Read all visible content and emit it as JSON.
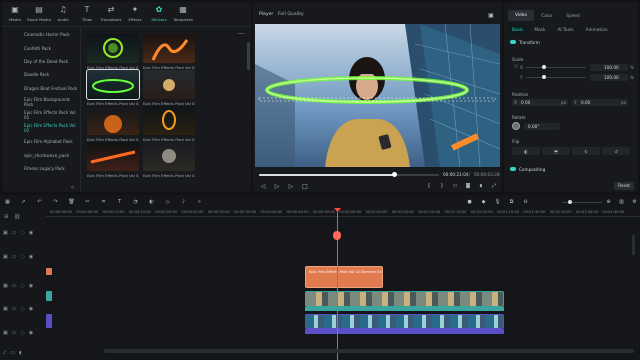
{
  "toolbar": {
    "items": [
      {
        "icon": "media-icon",
        "label": "Media"
      },
      {
        "icon": "stock-media-icon",
        "label": "Stock Media"
      },
      {
        "icon": "audio-icon",
        "label": "Audio"
      },
      {
        "icon": "titles-icon",
        "label": "Titles"
      },
      {
        "icon": "transitions-icon",
        "label": "Transitions"
      },
      {
        "icon": "effects-icon",
        "label": "Effects"
      },
      {
        "icon": "stickers-icon",
        "label": "Stickers"
      },
      {
        "icon": "templates-icon",
        "label": "Templates"
      }
    ],
    "active": "Stickers"
  },
  "categories": [
    "Cinematic Horror Pack",
    "Confetti Pack",
    "Day of the Dead Pack",
    "Doodle Pack",
    "Dragon Boat Festival Pack",
    "Epic Film Backgrounds Pack",
    "Epic Film Effects Pack Vol 01",
    "Epic Film Effects Pack Vol 02",
    "Epic Film Alphabet Pack",
    "epic_shockwave_pack",
    "Fitness Legacy Pack"
  ],
  "active_category": "Epic Film Effects Pack Vol 02",
  "thumbs": [
    "Epic Film Effects Pack Vol 02...",
    "Epic Film Effects Pack Vol 02...",
    "Epic Film Effects Pack Vol 02...",
    "Epic Film Effects Pack Vol 02...",
    "Epic Film Effects Pack Vol 02...",
    "Epic Film Effects Pack Vol 02...",
    "Epic Film Effects Pack Vol 02...",
    "Epic Film Effects Pack Vol 02..."
  ],
  "player": {
    "label": "Player",
    "quality": "Full Quality",
    "time_current": "00:00:21:04",
    "time_total": "00:00:03:28",
    "progress": 0.75
  },
  "props": {
    "tabs": [
      "Video",
      "Color",
      "Speed"
    ],
    "subtabs": [
      "Basic",
      "Mask",
      "AI Tools",
      "Animation"
    ],
    "transform": "Transform",
    "scale": "Scale",
    "scale_x": "100.00",
    "scale_y": "100.00",
    "pct": "%",
    "position": "Position",
    "pos_x": "0.00",
    "pos_y": "0.00",
    "px": "px",
    "x": "X",
    "y": "Y",
    "rotate": "Rotate",
    "rotate_val": "0.00°",
    "flip": "Flip",
    "compositing": "Compositing",
    "reset": "Reset"
  },
  "ruler": [
    "00:00:00:00",
    "00:00:05:00",
    "00:00:10:00",
    "00:00:15:00",
    "00:00:20:00",
    "00:00:25:00",
    "00:00:30:00",
    "00:00:35:00",
    "00:00:40:00",
    "00:00:45:00",
    "00:00:50:00",
    "00:00:55:00",
    "00:01:00:00",
    "00:01:05:00",
    "00:01:10:00",
    "00:01:15:00",
    "00:01:20:00",
    "00:01:25:00",
    "00:01:30:00",
    "00:01:35:00",
    "00:01:40:00",
    "00:01:45:00",
    "00:01:50:00",
    "00:01:55:00"
  ],
  "clips": {
    "sticker": "Epic Film Effects Pack Vol 02 Element 03"
  },
  "colors": {
    "accent": "#35d6c4",
    "sticker_clip": "#e07a4f",
    "playhead": "#ff4a4a",
    "video_clip": "#3ba6a0",
    "audio_clip": "#5b4fc8"
  }
}
